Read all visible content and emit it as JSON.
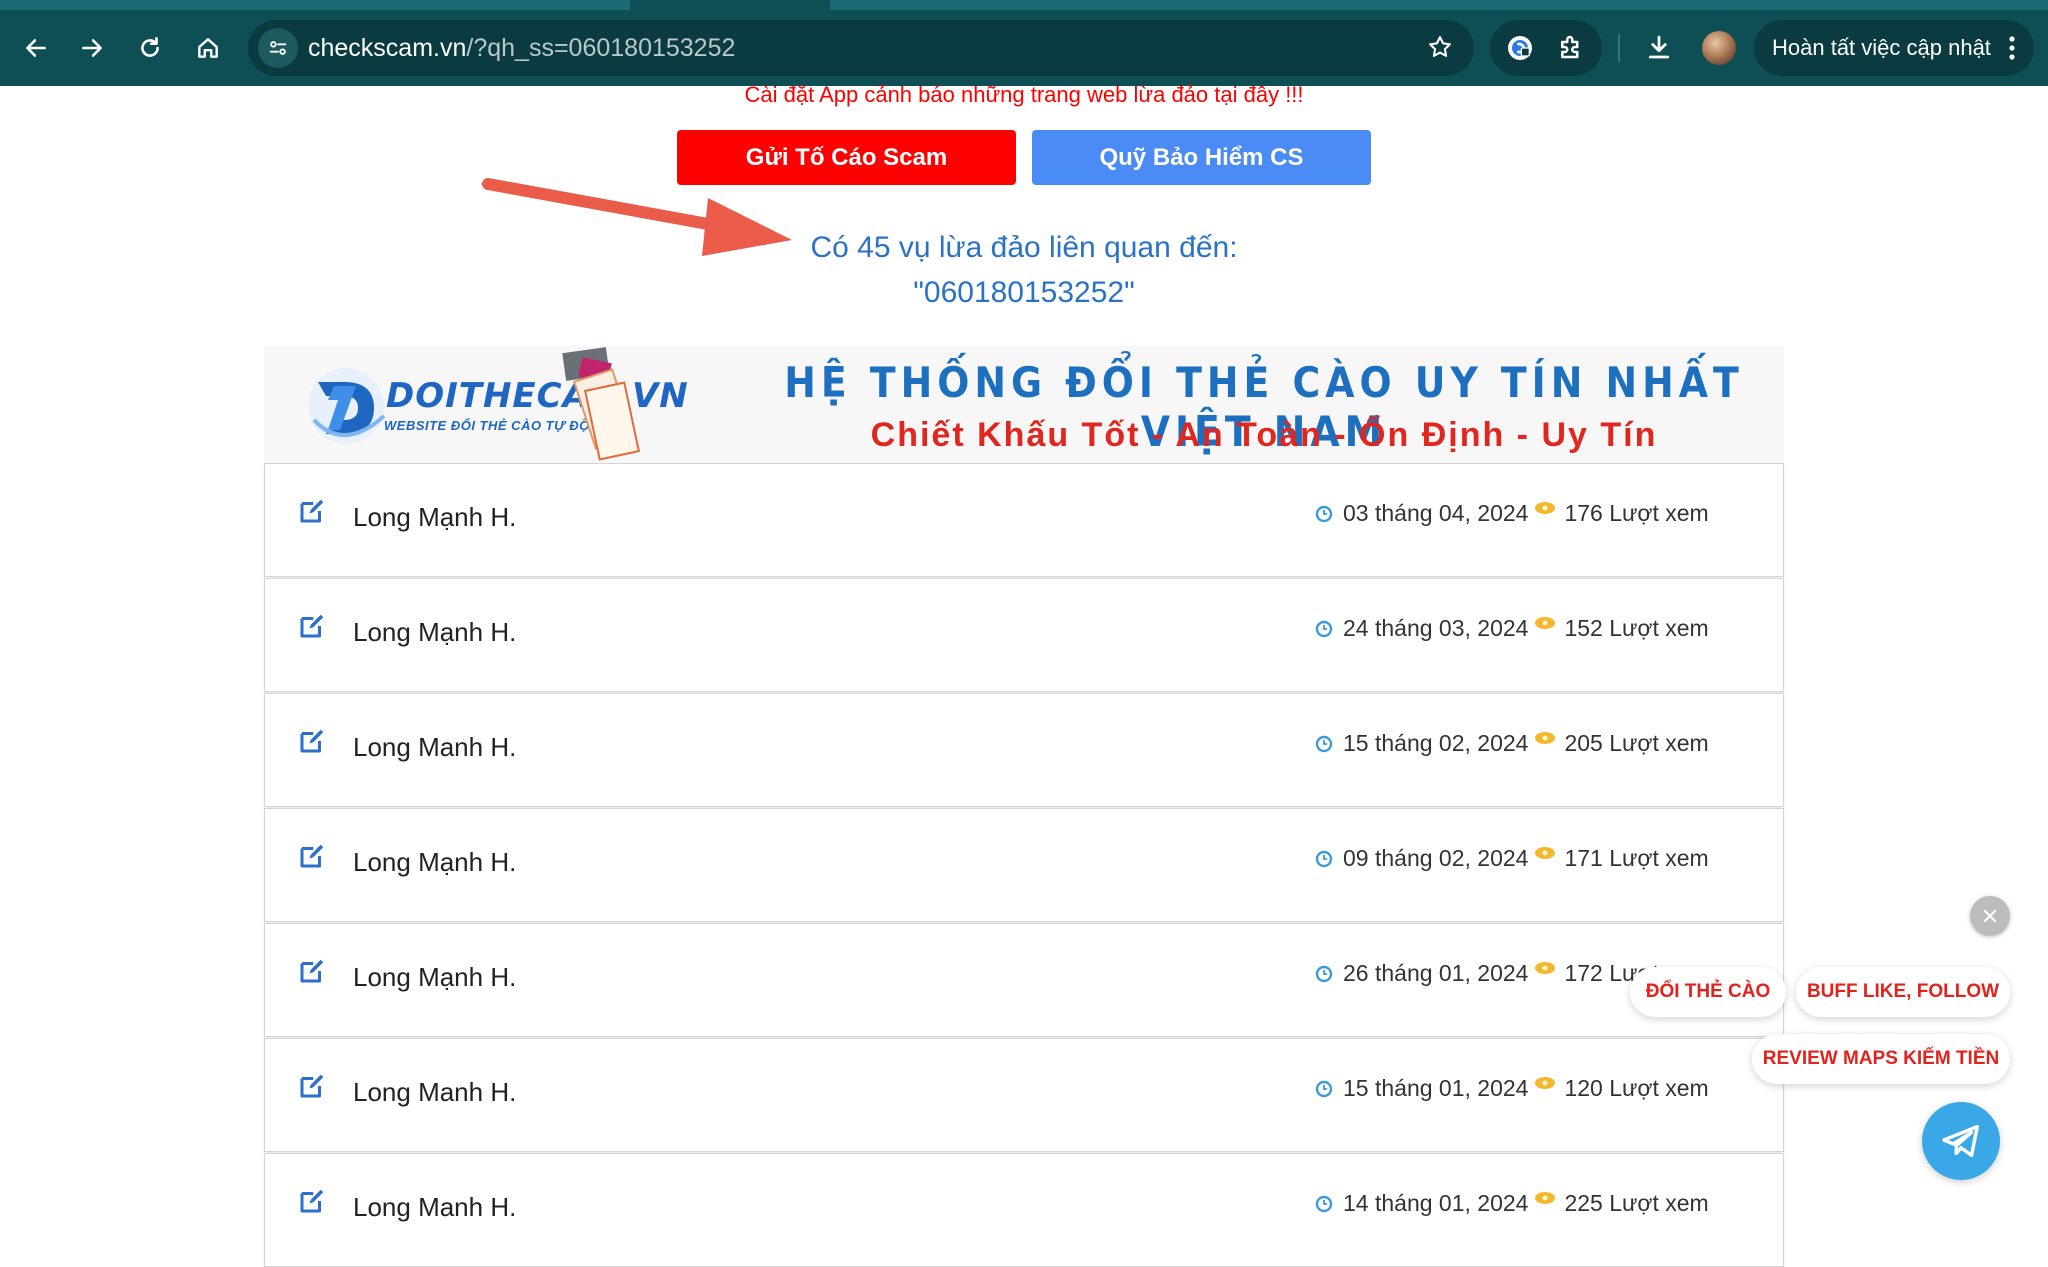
{
  "browser": {
    "url_host": "checkscam.vn",
    "url_path": "/?qh_ss=060180153252",
    "update_label": "Hoàn tất việc cập nhật"
  },
  "page": {
    "promo_link": "Cài đặt App cảnh báo những trang web lừa đảo tại đây !!!",
    "report_button": "Gửi Tố Cáo Scam",
    "insurance_button": "Quỹ Bảo Hiểm CS",
    "count_line1": "Có 45 vụ lừa đảo liên quan đến:",
    "count_line2": "\"060180153252\""
  },
  "banner": {
    "logo_text": "DOITHECAO.VN",
    "logo_subtext": "WEBSITE ĐỔI THẺ CÀO TỰ ĐỘNG",
    "headline": "HỆ THỐNG ĐỔI THẺ CÀO UY TÍN NHẤT VIỆT NAM",
    "tagline": "Chiết Khấu Tốt - An Toàn - Ổn Định - Uy Tín"
  },
  "reports": [
    {
      "name": "Long Mạnh H.",
      "date": "03 tháng 04, 2024",
      "views": "176 Lượt xem"
    },
    {
      "name": "Long Mạnh H.",
      "date": "24 tháng 03, 2024",
      "views": "152 Lượt xem"
    },
    {
      "name": "Long Manh H.",
      "date": "15 tháng 02, 2024",
      "views": "205 Lượt xem"
    },
    {
      "name": "Long Mạnh H.",
      "date": "09 tháng 02, 2024",
      "views": "171 Lượt xem"
    },
    {
      "name": "Long Mạnh H.",
      "date": "26 tháng 01, 2024",
      "views": "172 Lượt"
    },
    {
      "name": "Long Manh H.",
      "date": "15 tháng 01, 2024",
      "views": "120 Lượt xem"
    },
    {
      "name": "Long Manh H.",
      "date": "14 tháng 01, 2024",
      "views": "225 Lượt xem"
    }
  ],
  "widgets": {
    "doi_the_cao": "ĐỔI THẺ CÀO",
    "buff_like": "BUFF LIKE, FOLLOW",
    "review_maps": "REVIEW MAPS KIẾM TIỀN"
  },
  "colors": {
    "chrome_bg": "#0e4f56",
    "red": "#ff0000",
    "blue_button": "#4a8bf5",
    "count_text": "#2a72c6",
    "banner_blue": "#1d6fc0",
    "banner_red": "#e0261f"
  }
}
